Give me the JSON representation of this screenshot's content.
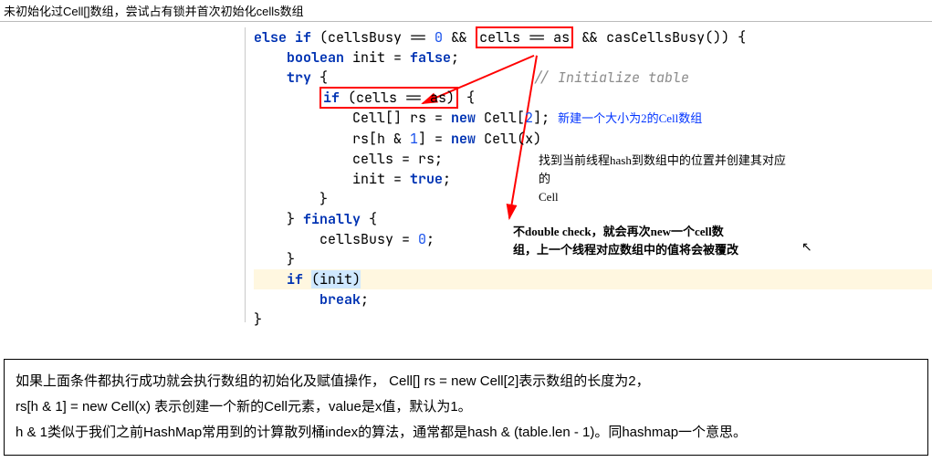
{
  "header": "未初始化过Cell[]数组，尝试占有锁并首次初始化cells数组",
  "code": {
    "l1a": "else if",
    "l1b": " (cellsBusy == ",
    "l1c": "0",
    "l1d": " && ",
    "l1e": "cells == as",
    "l1f": " && casCellsBusy()) {",
    "l2a": "    boolean",
    "l2b": " init = ",
    "l2c": "false",
    "l2d": ";",
    "l3a": "    try",
    "l3b": " {",
    "l3c": "                         // Initialize table",
    "l4a": "        ",
    "l4b": "if",
    "l4c": " (cells == as)",
    "l4d": " {",
    "l5a": "            Cell[] rs = ",
    "l5b": "new",
    "l5c": " Cell[",
    "l5d": "2",
    "l5e": "];",
    "l5f": "新建一个大小为2的Cell数组",
    "l6a": "            rs[h & ",
    "l6b": "1",
    "l6c": "] = ",
    "l6d": "new",
    "l6e": " Cell(x)",
    "l7a": "            cells = rs;",
    "l8a": "            init = ",
    "l8b": "true",
    "l8c": ";",
    "l9a": "        }",
    "l10a": "    } ",
    "l10b": "finally",
    "l10c": " {",
    "l11a": "        cellsBusy = ",
    "l11b": "0",
    "l11c": ";",
    "l12a": "    }",
    "l13a": "    if ",
    "l13b": "(init)",
    "l14a": "        break",
    "l14b": ";",
    "l15a": "}"
  },
  "anno": {
    "side1a": "找到当前线程hash到数组中的位置并创建其对应的",
    "side1b": "Cell",
    "side2a": "不double check，就会再次new一个cell数",
    "side2b": "组，上一个线程对应数组中的值将会被覆改"
  },
  "below": {
    "p1": "如果上面条件都执行成功就会执行数组的初始化及赋值操作， Cell[] rs = new Cell[2]表示数组的长度为2，",
    "p2": "rs[h & 1] = new Cell(x) 表示创建一个新的Cell元素，value是x值，默认为1。",
    "p3": "h & 1类似于我们之前HashMap常用到的计算散列桶index的算法，通常都是hash & (table.len - 1)。同hashmap一个意思。"
  }
}
